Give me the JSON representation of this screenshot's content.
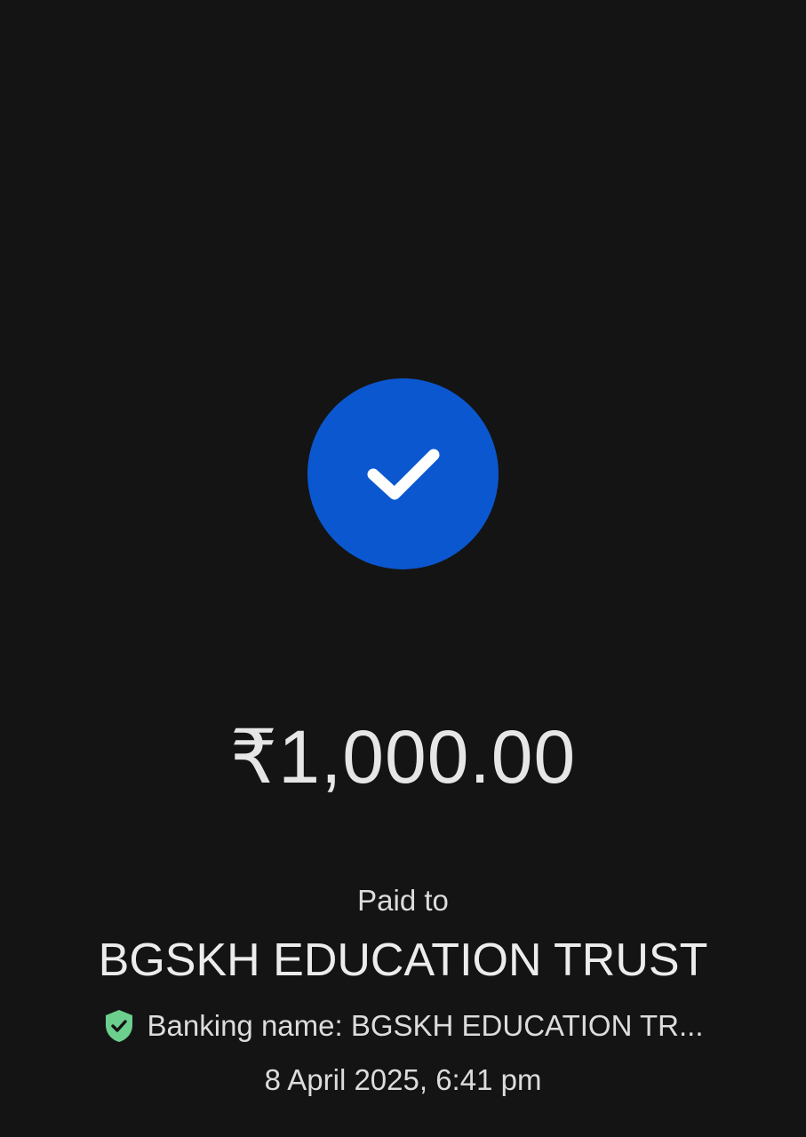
{
  "colors": {
    "background": "#141414",
    "success_circle": "#0b57d0",
    "check_mark": "#ffffff",
    "verified_shield": "#6ccf8e",
    "text_primary": "#e8e8e8"
  },
  "status": {
    "icon": "check-icon"
  },
  "payment": {
    "amount": "₹1,000.00",
    "paid_to_label": "Paid to",
    "payee_name": "BGSKH EDUCATION TRUST",
    "banking_name": "Banking name: BGSKH EDUCATION TR...",
    "banking_icon": "verified-shield-icon",
    "datetime": "8 April 2025, 6:41 pm"
  }
}
